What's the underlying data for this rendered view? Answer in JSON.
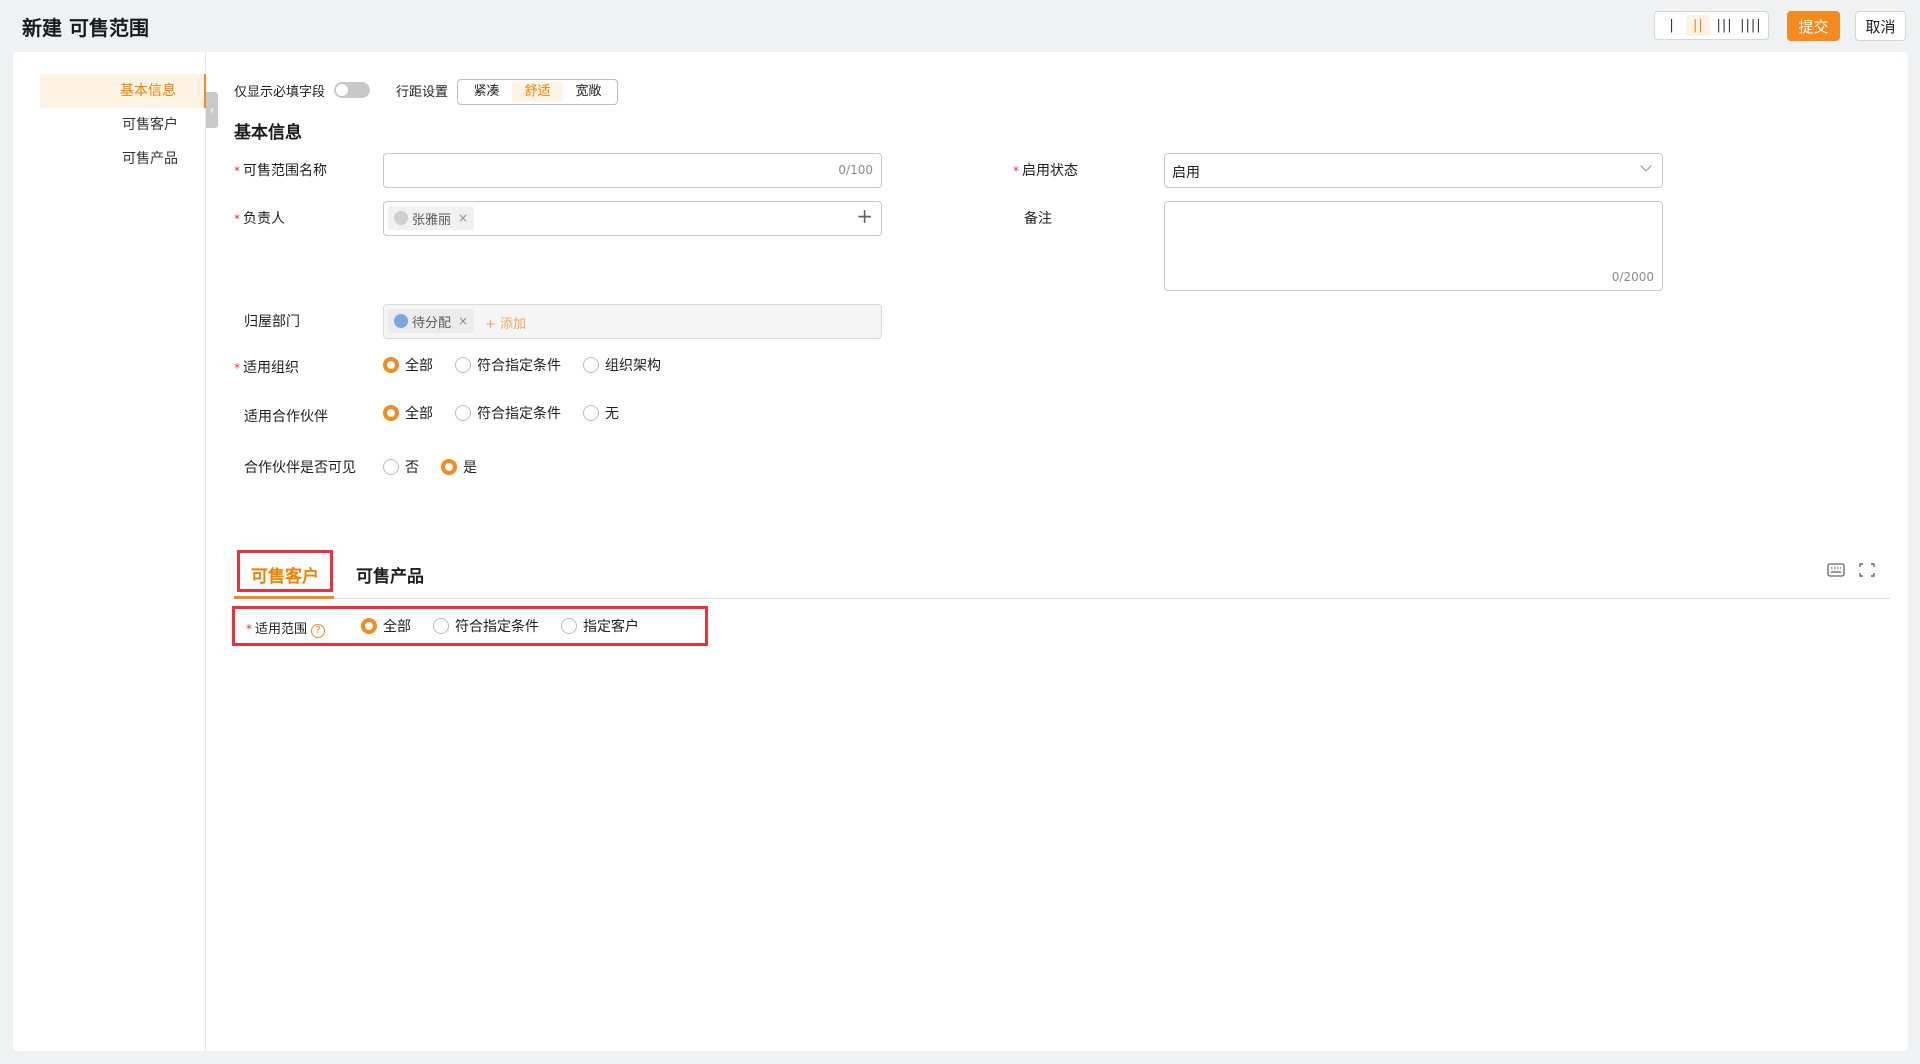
{
  "header": {
    "title": "新建 可售范围",
    "column_options": [
      "|",
      "||",
      "|||",
      "||||"
    ],
    "active_column_index": 1,
    "submit_label": "提交",
    "cancel_label": "取消"
  },
  "sidenav": {
    "items": [
      {
        "label": "基本信息",
        "active": true
      },
      {
        "label": "可售客户",
        "active": false
      },
      {
        "label": "可售产品",
        "active": false
      }
    ]
  },
  "toolbar": {
    "required_only_label": "仅显示必填字段",
    "spacing_label": "行距设置",
    "spacing_options": [
      "紧凑",
      "舒适",
      "宽敞"
    ],
    "spacing_active": "舒适"
  },
  "section_title": "基本信息",
  "form": {
    "name": {
      "label": "可售范围名称",
      "required": true,
      "value": "",
      "counter": "0/100"
    },
    "status": {
      "label": "启用状态",
      "required": true,
      "value": "启用"
    },
    "owner": {
      "label": "负责人",
      "required": true,
      "tag": "张雅丽",
      "tag_close": "×",
      "add_icon": "+"
    },
    "remark": {
      "label": "备注",
      "required": false,
      "value": "",
      "counter": "0/2000"
    },
    "department": {
      "label": "归屋部门",
      "required": false,
      "tag": "待分配",
      "tag_close": "×",
      "add_label": "+ 添加"
    },
    "org": {
      "label": "适用组织",
      "required": true,
      "options": [
        "全部",
        "符合指定条件",
        "组织架构"
      ],
      "selected": 0
    },
    "partner": {
      "label": "适用合作伙伴",
      "required": false,
      "options": [
        "全部",
        "符合指定条件",
        "无"
      ],
      "selected": 0
    },
    "partner_visible": {
      "label": "合作伙伴是否可见",
      "required": false,
      "options": [
        "否",
        "是"
      ],
      "selected": 1
    }
  },
  "tabs": {
    "items": [
      "可售客户",
      "可售产品"
    ],
    "active": 0
  },
  "scope": {
    "label": "适用范围",
    "required": true,
    "help_icon": "?",
    "options": [
      "全部",
      "符合指定条件",
      "指定客户"
    ],
    "selected": 0
  },
  "icons": {
    "required_mark": "*",
    "collapse": "‹"
  },
  "colors": {
    "accent": "#f58a1f",
    "highlight_box": "#e8333d"
  }
}
